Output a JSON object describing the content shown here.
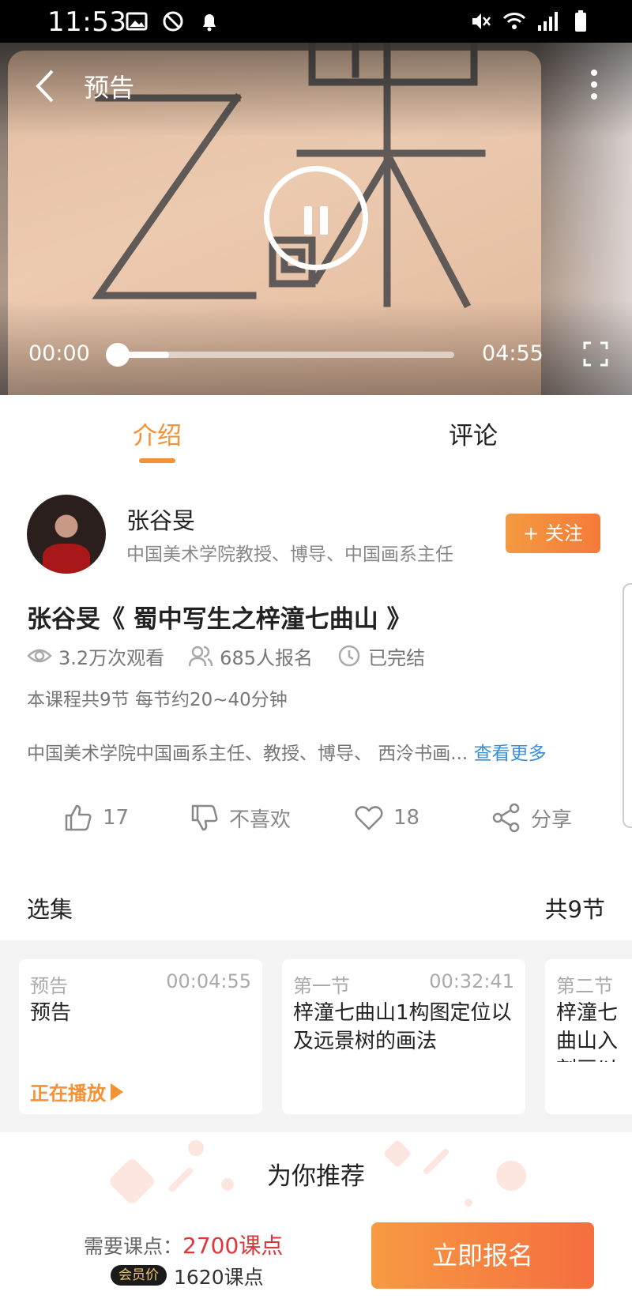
{
  "status_bar": {
    "time": "11:53"
  },
  "video": {
    "title": "预告",
    "current_time": "00:00",
    "total_time": "04:55",
    "progress": 0.0,
    "buffered": 0.15
  },
  "tabs": [
    {
      "label": "介绍",
      "active": true
    },
    {
      "label": "评论",
      "active": false
    }
  ],
  "teacher": {
    "name": "张谷旻",
    "title": "中国美术学院教授、博导、中国画系主任",
    "follow_label": "+ 关注"
  },
  "course": {
    "title": "张谷旻《 蜀中写生之梓潼七曲山 》",
    "views": "3.2万次观看",
    "enrolled": "685人报名",
    "status": "已完结",
    "lessons_info": "本课程共9节 每节约20~40分钟",
    "description": "中国美术学院中国画系主任、教授、博导、 西泠书画...",
    "more_label": "查看更多"
  },
  "actions": {
    "like_count": "17",
    "dislike_label": "不喜欢",
    "favorite_count": "18",
    "share_label": "分享"
  },
  "episodes": {
    "section_title": "选集",
    "count_label": "共9节",
    "items": [
      {
        "tag": "预告",
        "duration": "00:04:55",
        "title": "预告",
        "playing_label": "正在播放"
      },
      {
        "tag": "第一节",
        "duration": "00:32:41",
        "title": "梓潼七曲山1构图定位以及远景树的画法"
      },
      {
        "tag": "第二节",
        "duration": "",
        "title": "梓潼七曲山入刻画以"
      }
    ]
  },
  "recommend": {
    "title": "为你推荐"
  },
  "purchase": {
    "price_label": "需要课点：",
    "price_value": "2700课点",
    "vip_label": "会员价",
    "vip_price": "1620课点",
    "enroll_label": "立即报名"
  },
  "colors": {
    "accent": "#f39237",
    "price_red": "#e0353a",
    "link_blue": "#3a8fd6"
  }
}
